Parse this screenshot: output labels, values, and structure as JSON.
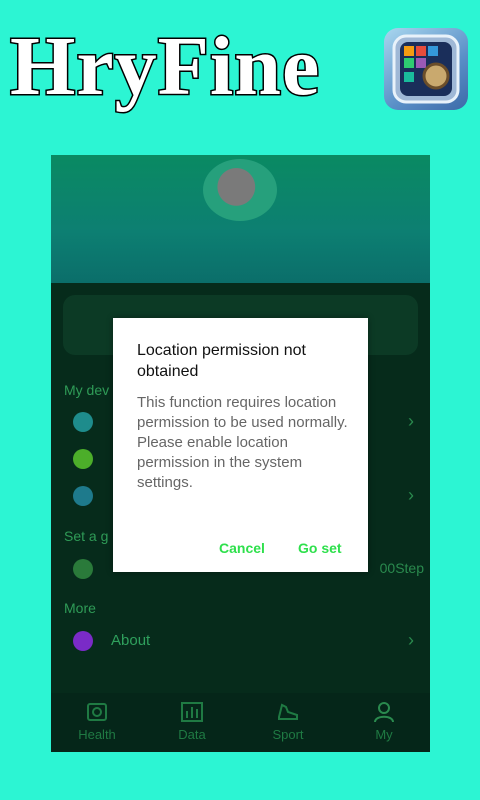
{
  "brand": {
    "title": "HryFine"
  },
  "sections": {
    "devices": "My dev",
    "goal": "Set a g",
    "more": "More"
  },
  "goal": {
    "steps": "00Step"
  },
  "menu": {
    "about": "About"
  },
  "tabs": [
    {
      "label": "Health"
    },
    {
      "label": "Data"
    },
    {
      "label": "Sport"
    },
    {
      "label": "My"
    }
  ],
  "dialog": {
    "title": "Location permission not obtained",
    "message": "This function requires location permission to be used normally. Please enable location permission in the system settings.",
    "cancel": "Cancel",
    "confirm": "Go set"
  },
  "colors": {
    "background": "#2cf5d3",
    "accent": "#2ee04c",
    "app_bg": "#062b1b"
  }
}
